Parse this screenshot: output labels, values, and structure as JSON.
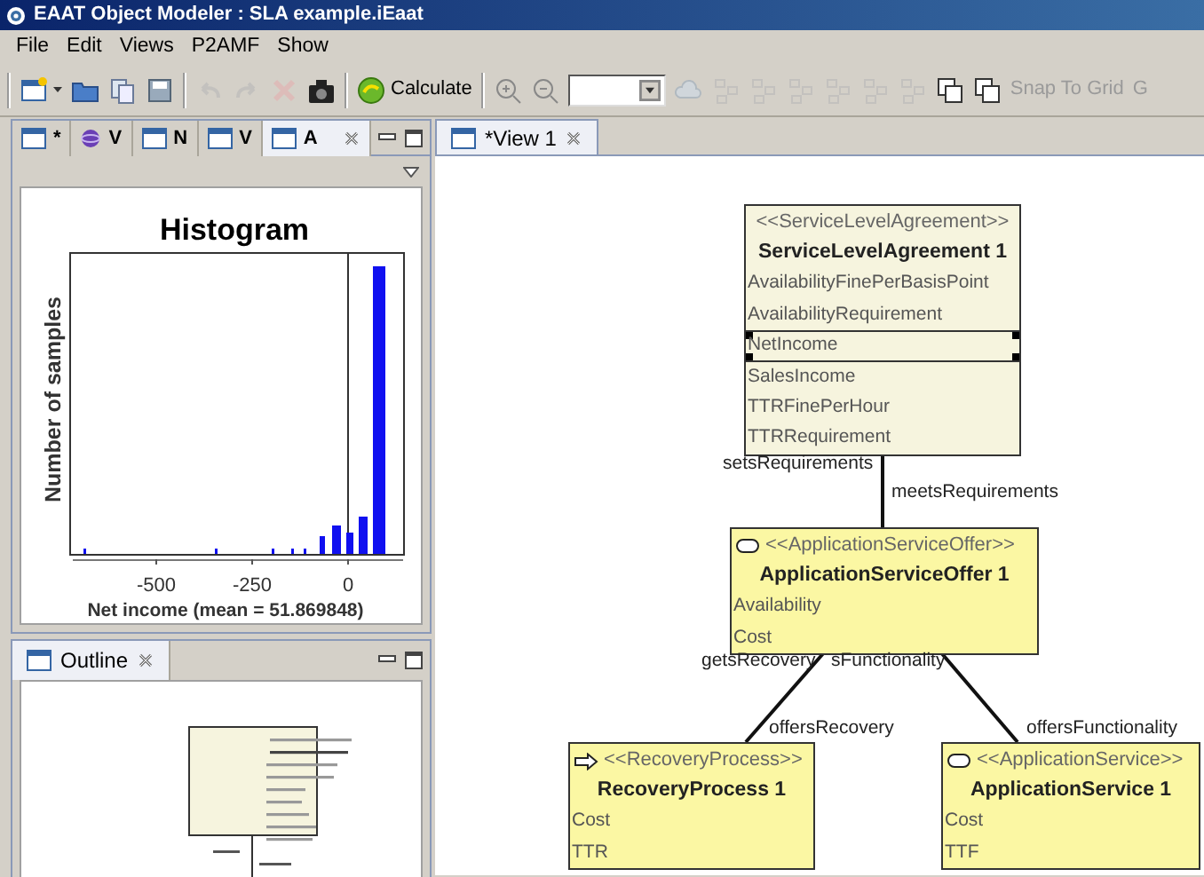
{
  "window": {
    "title": "EAAT Object Modeler : SLA example.iEaat"
  },
  "menu": [
    "File",
    "Edit",
    "Views",
    "P2AMF",
    "Show"
  ],
  "toolbar": [
    {
      "kind": "new",
      "disabled": false
    },
    {
      "kind": "open",
      "disabled": false
    },
    {
      "kind": "copy",
      "disabled": false
    },
    {
      "kind": "save",
      "disabled": false
    },
    {
      "kind": "separator"
    },
    {
      "kind": "undo",
      "disabled": true
    },
    {
      "kind": "redo",
      "disabled": true
    },
    {
      "kind": "delete",
      "disabled": true
    },
    {
      "kind": "toolbox",
      "disabled": false
    },
    {
      "kind": "separator"
    },
    {
      "kind": "calculate",
      "label": "Calculate",
      "disabled": false
    },
    {
      "kind": "separator"
    },
    {
      "kind": "zoomin",
      "disabled": false
    },
    {
      "kind": "zoomout",
      "disabled": false
    },
    {
      "kind": "combo"
    },
    {
      "kind": "refresh",
      "disabled": true
    },
    {
      "kind": "layout",
      "disabled": true
    },
    {
      "kind": "layout",
      "disabled": true
    },
    {
      "kind": "layout",
      "disabled": true
    },
    {
      "kind": "layout",
      "disabled": true
    },
    {
      "kind": "layout",
      "disabled": true
    },
    {
      "kind": "layout",
      "disabled": true
    },
    {
      "kind": "stack",
      "disabled": false
    },
    {
      "kind": "stack",
      "disabled": false
    },
    {
      "kind": "text",
      "label": "Snap To Grid",
      "disabled": true
    },
    {
      "kind": "text",
      "label": "G",
      "disabled": true
    }
  ],
  "view_tabs": [
    {
      "kind": "view",
      "label": "*",
      "selected": false
    },
    {
      "kind": "model",
      "label": "V",
      "selected": false
    },
    {
      "kind": "view",
      "label": "N",
      "selected": false
    },
    {
      "kind": "view",
      "label": "V",
      "selected": false
    },
    {
      "kind": "view",
      "label": "A",
      "selected": true
    }
  ],
  "histogram": {
    "title": "Histogram",
    "ylabel": "Number of samples",
    "xlabel": "Net income (mean = 51.869848)",
    "xtick_labels": [
      "-500",
      "-250",
      "0"
    ]
  },
  "outline": {
    "tab": {
      "label": "Outline",
      "selected": true
    }
  },
  "editor": {
    "tab": {
      "label": "*View 1",
      "selected": true
    },
    "nodes": [
      {
        "kind": "agreement",
        "stereotype": "<<ServiceLevelAgreement>>",
        "name": "ServiceLevelAgreement 1",
        "attributes": [
          {
            "label": "AvailabilityFinePerBasisPoint",
            "selected": false
          },
          {
            "label": "AvailabilityRequirement",
            "selected": false
          },
          {
            "label": "NetIncome",
            "selected": true
          },
          {
            "label": "SalesIncome",
            "selected": false
          },
          {
            "label": "TTRFinePerHour",
            "selected": false
          },
          {
            "label": "TTRRequirement",
            "selected": false
          }
        ]
      },
      {
        "kind": "offer",
        "stereotype": "<<ApplicationServiceOffer>>",
        "name": "ApplicationServiceOffer 1",
        "attributes": [
          {
            "label": "Availability",
            "selected": false
          },
          {
            "label": "Cost",
            "selected": false
          }
        ]
      },
      {
        "kind": "process",
        "stereotype": "<<RecoveryProcess>>",
        "name": "RecoveryProcess 1",
        "attributes": [
          {
            "label": "Cost",
            "selected": false
          },
          {
            "label": "TTR",
            "selected": false
          }
        ]
      },
      {
        "kind": "service",
        "stereotype": "<<ApplicationService>>",
        "name": "ApplicationService 1",
        "attributes": [
          {
            "label": "Cost",
            "selected": false
          },
          {
            "label": "TTF",
            "selected": false
          }
        ]
      }
    ],
    "edges": [
      {
        "labels": [
          "setsRequirements",
          "meetsRequirements"
        ]
      },
      {
        "labels": [
          "getsRecovery",
          "offersRecovery"
        ]
      },
      {
        "labels": [
          "sFunctionality",
          "offersFunctionality"
        ]
      }
    ]
  }
}
